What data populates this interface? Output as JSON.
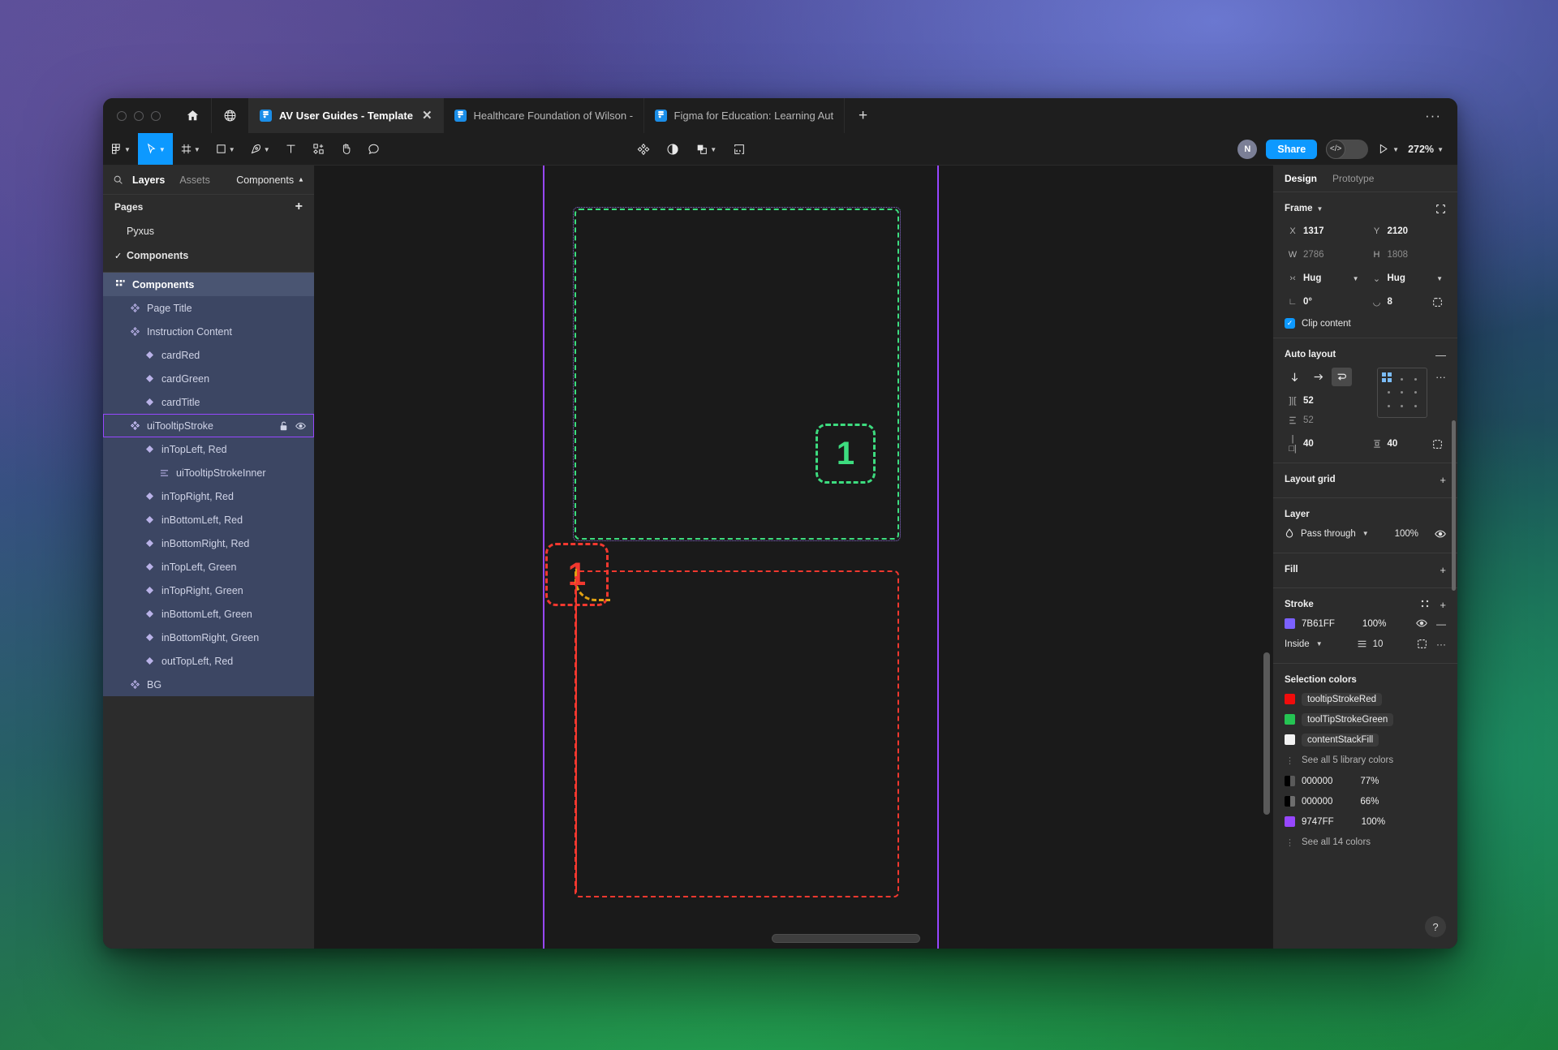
{
  "window": {
    "tabs": [
      {
        "label": "AV User Guides - Template",
        "active": true,
        "icon": "figma-file-icon",
        "closable": true
      },
      {
        "label": "Healthcare Foundation of Wilson - Us",
        "active": false,
        "icon": "figma-file-icon",
        "closable": false
      },
      {
        "label": "Figma for Education: Learning Auto la",
        "active": false,
        "icon": "figma-file-icon",
        "closable": false
      }
    ],
    "new_tab_label": "+",
    "more_label": "···",
    "home_icon": "home-icon",
    "globe_icon": "globe-icon"
  },
  "toolbar": {
    "left_tools": [
      {
        "name": "main-menu",
        "icon": "figma-logo-icon",
        "caret": true,
        "selected": false
      },
      {
        "name": "move-tool",
        "icon": "cursor-icon",
        "caret": true,
        "selected": true
      },
      {
        "name": "frame-tool",
        "icon": "frame-icon",
        "caret": true,
        "selected": false
      },
      {
        "name": "shape-tool",
        "icon": "square-icon",
        "caret": true,
        "selected": false
      },
      {
        "name": "pen-tool",
        "icon": "pen-icon",
        "caret": true,
        "selected": false
      },
      {
        "name": "text-tool",
        "icon": "text-icon",
        "caret": false,
        "selected": false
      },
      {
        "name": "actions-tool",
        "icon": "resources-icon",
        "caret": false,
        "selected": false
      },
      {
        "name": "hand-tool",
        "icon": "hand-icon",
        "caret": false,
        "selected": false
      },
      {
        "name": "comment-tool",
        "icon": "comment-icon",
        "caret": false,
        "selected": false
      }
    ],
    "center_tools": [
      {
        "name": "components-button",
        "icon": "components-icon",
        "caret": false
      },
      {
        "name": "contrast-button",
        "icon": "contrast-icon",
        "caret": false
      },
      {
        "name": "boolean-button",
        "icon": "boolean-icon",
        "caret": true
      },
      {
        "name": "dev-mode-button",
        "icon": "code-icon",
        "caret": false
      }
    ],
    "avatar_initial": "N",
    "share_label": "Share",
    "dev_toggle_icon": "code-icon",
    "present_icon": "play-icon",
    "zoom_level": "272%"
  },
  "left_panel": {
    "search_icon": "search-icon",
    "tabs": [
      {
        "label": "Layers",
        "active": true
      },
      {
        "label": "Assets",
        "active": false
      }
    ],
    "components_dropdown": "Components",
    "pages": {
      "title": "Pages",
      "add_label": "+",
      "items": [
        {
          "label": "Pyxus",
          "current": false
        },
        {
          "label": "Components",
          "current": true
        }
      ]
    },
    "layers": [
      {
        "label": "Components",
        "depth": 0,
        "icon": "component-set-icon",
        "state": "group-root"
      },
      {
        "label": "Page Title",
        "depth": 1,
        "icon": "component-icon",
        "state": "in-sel"
      },
      {
        "label": "Instruction Content",
        "depth": 1,
        "icon": "component-icon",
        "state": "in-sel"
      },
      {
        "label": "cardRed",
        "depth": 2,
        "icon": "instance-icon",
        "state": "in-sel"
      },
      {
        "label": "cardGreen",
        "depth": 2,
        "icon": "instance-icon",
        "state": "in-sel"
      },
      {
        "label": "cardTitle",
        "depth": 2,
        "icon": "instance-icon",
        "state": "in-sel"
      },
      {
        "label": "uiTooltipStroke",
        "depth": 1,
        "icon": "component-icon",
        "state": "active-sel",
        "lock_icon": "unlock-icon",
        "visible_icon": "eye-icon"
      },
      {
        "label": "inTopLeft, Red",
        "depth": 2,
        "icon": "instance-icon",
        "state": "in-sel"
      },
      {
        "label": "uiTooltipStrokeInner",
        "depth": 3,
        "icon": "autolayout-icon",
        "state": "in-sel"
      },
      {
        "label": "inTopRight, Red",
        "depth": 2,
        "icon": "instance-icon",
        "state": "in-sel"
      },
      {
        "label": "inBottomLeft, Red",
        "depth": 2,
        "icon": "instance-icon",
        "state": "in-sel"
      },
      {
        "label": "inBottomRight, Red",
        "depth": 2,
        "icon": "instance-icon",
        "state": "in-sel"
      },
      {
        "label": "inTopLeft, Green",
        "depth": 2,
        "icon": "instance-icon",
        "state": "in-sel"
      },
      {
        "label": "inTopRight, Green",
        "depth": 2,
        "icon": "instance-icon",
        "state": "in-sel"
      },
      {
        "label": "inBottomLeft, Green",
        "depth": 2,
        "icon": "instance-icon",
        "state": "in-sel"
      },
      {
        "label": "inBottomRight, Green",
        "depth": 2,
        "icon": "instance-icon",
        "state": "in-sel"
      },
      {
        "label": "outTopLeft, Red",
        "depth": 2,
        "icon": "instance-icon",
        "state": "in-sel"
      },
      {
        "label": "BG",
        "depth": 1,
        "icon": "component-icon",
        "state": "in-sel"
      }
    ]
  },
  "canvas": {
    "green_badge_number": "1",
    "red_badge_number": "1",
    "guide_color": "#9747FF",
    "green_stroke_color": "#3DDC7F",
    "red_stroke_color": "#F2382F",
    "orange_stroke_color": "#E0A011"
  },
  "right_panel": {
    "tabs": [
      {
        "label": "Design",
        "active": true
      },
      {
        "label": "Prototype",
        "active": false
      }
    ],
    "frame": {
      "title": "Frame",
      "collapse_icon": "collapse-icon",
      "x_label": "X",
      "x_value": "1317",
      "y_label": "Y",
      "y_value": "2120",
      "w_label": "W",
      "w_value": "2786",
      "h_label": "H",
      "h_value": "1808",
      "hug_horizontal": "Hug",
      "hug_vertical": "Hug",
      "rotation": "0°",
      "corner_radius": "8",
      "clip_content_label": "Clip content",
      "clip_content_checked": true
    },
    "auto_layout": {
      "title": "Auto layout",
      "remove_label": "—",
      "directions": [
        {
          "name": "vertical-direction",
          "icon": "arrow-down-icon",
          "selected": false
        },
        {
          "name": "horizontal-direction",
          "icon": "arrow-right-icon",
          "selected": false
        },
        {
          "name": "wrap-direction",
          "icon": "wrap-icon",
          "selected": true
        }
      ],
      "horizontal_gap": "52",
      "vertical_gap": "52",
      "horizontal_padding": "40",
      "vertical_padding": "40",
      "more_label": "···",
      "alignment": "top-left"
    },
    "layout_grid": {
      "title": "Layout grid",
      "add_label": "+"
    },
    "layer": {
      "title": "Layer",
      "blend_mode": "Pass through",
      "opacity": "100%",
      "visible_icon": "eye-icon"
    },
    "fill": {
      "title": "Fill",
      "add_label": "+"
    },
    "stroke": {
      "title": "Stroke",
      "styles_icon": "styles-icon",
      "add_label": "+",
      "color_hex": "7B61FF",
      "color_value": "#7B61FF",
      "opacity": "100%",
      "align": "Inside",
      "weight": "10",
      "advanced_icon": "advanced-stroke-icon",
      "more_label": "···"
    },
    "selection_colors": {
      "title": "Selection colors",
      "items": [
        {
          "name": "tooltipStrokeRed",
          "color": "#F00C0C",
          "is_style": true
        },
        {
          "name": "toolTipStrokeGreen",
          "color": "#25C453",
          "is_style": true
        },
        {
          "name": "contentStackFill",
          "color": "#F2F2F2",
          "is_style": true
        }
      ],
      "see_library_label": "See all 5 library colors",
      "raw_colors": [
        {
          "hex": "000000",
          "opacity": "77%",
          "color": "#000000"
        },
        {
          "hex": "000000",
          "opacity": "66%",
          "color": "#000000"
        },
        {
          "hex": "9747FF",
          "opacity": "100%",
          "color": "#9747FF"
        }
      ],
      "see_all_label": "See all 14 colors"
    },
    "help_label": "?"
  }
}
